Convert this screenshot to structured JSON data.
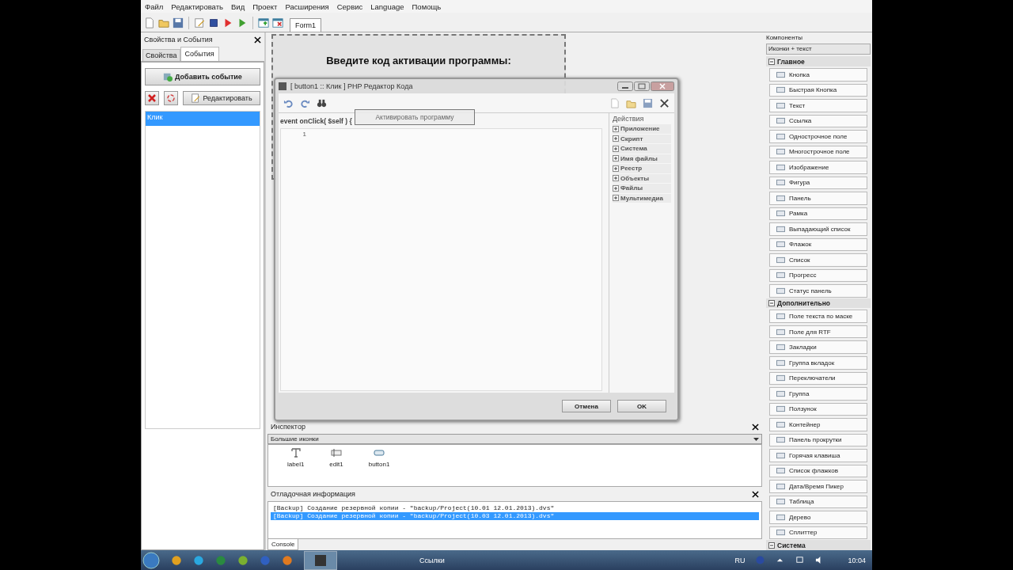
{
  "menu": [
    "Файл",
    "Редактировать",
    "Вид",
    "Проект",
    "Расширения",
    "Сервис",
    "Language",
    "Помощь"
  ],
  "toolbar": {
    "tabs": [
      {
        "label": "Form1",
        "selected": true
      }
    ]
  },
  "properties_panel": {
    "title": "Свойства и События",
    "tabs": [
      {
        "label": "Свойства",
        "selected": false
      },
      {
        "label": "События",
        "selected": true
      }
    ],
    "add_button": "Добавить событие",
    "edit_button": "Редактировать",
    "events": [
      {
        "label": "Клик",
        "selected": true
      }
    ]
  },
  "form": {
    "label": "Введите код активации программы:",
    "button": "Активировать программу"
  },
  "code_editor": {
    "title": "[ button1 :: Клик ] PHP Редактор Кода",
    "header": "event onClick( $self ) {",
    "line_numbers": [
      "1"
    ],
    "actions_title": "Действия",
    "actions": [
      "Приложение",
      "Скрипт",
      "Система",
      "Имя файлы",
      "Реестр",
      "Объекты",
      "Файлы",
      "Мультимедиа"
    ],
    "buttons": [
      "Отмена",
      "OK"
    ]
  },
  "inspector": {
    "title": "Инспектор",
    "view": "Большие иконки",
    "items": [
      {
        "label": "label1",
        "kind": "label"
      },
      {
        "label": "edit1",
        "kind": "edit"
      },
      {
        "label": "button1",
        "kind": "button"
      }
    ]
  },
  "debug": {
    "title": "Отладочная информация",
    "lines": [
      {
        "text": "[Backup] Создание резервной копии - \"backup/Project(10.01 12.01.2013).dvs\"",
        "selected": false
      },
      {
        "text": "[Backup] Создание резервной копии - \"backup/Project(10.03 12.01.2013).dvs\"",
        "selected": true
      }
    ],
    "tabs": [
      "Console"
    ]
  },
  "components": {
    "title": "Компоненты",
    "view": "Иконки + текст",
    "groups": [
      {
        "title": "Главное",
        "expanded": true,
        "items": [
          "Кнопка",
          "Быстрая Кнопка",
          "Текст",
          "Ссылка",
          "Однострочное поле",
          "Многострочное поле",
          "Изображение",
          "Фигура",
          "Панель",
          "Рамка",
          "Выпадающий список",
          "Флажок",
          "Список",
          "Прогресс",
          "Статус панель"
        ]
      },
      {
        "title": "Дополнительно",
        "expanded": true,
        "items": [
          "Поле текста по маске",
          "Поле для RTF",
          "Закладки",
          "Группа вкладок",
          "Переключатели",
          "Группа",
          "Ползунок",
          "Контейнер",
          "Панель прокрутки",
          "Горячая клавиша",
          "Список флажков",
          "Дата/Время Пикер",
          "Таблица",
          "Дерево",
          "Сплиттер"
        ]
      },
      {
        "title": "Система",
        "expanded": true
      }
    ]
  },
  "taskbar": {
    "active_task": "Ссылки",
    "language": "RU",
    "time": "10:04"
  }
}
